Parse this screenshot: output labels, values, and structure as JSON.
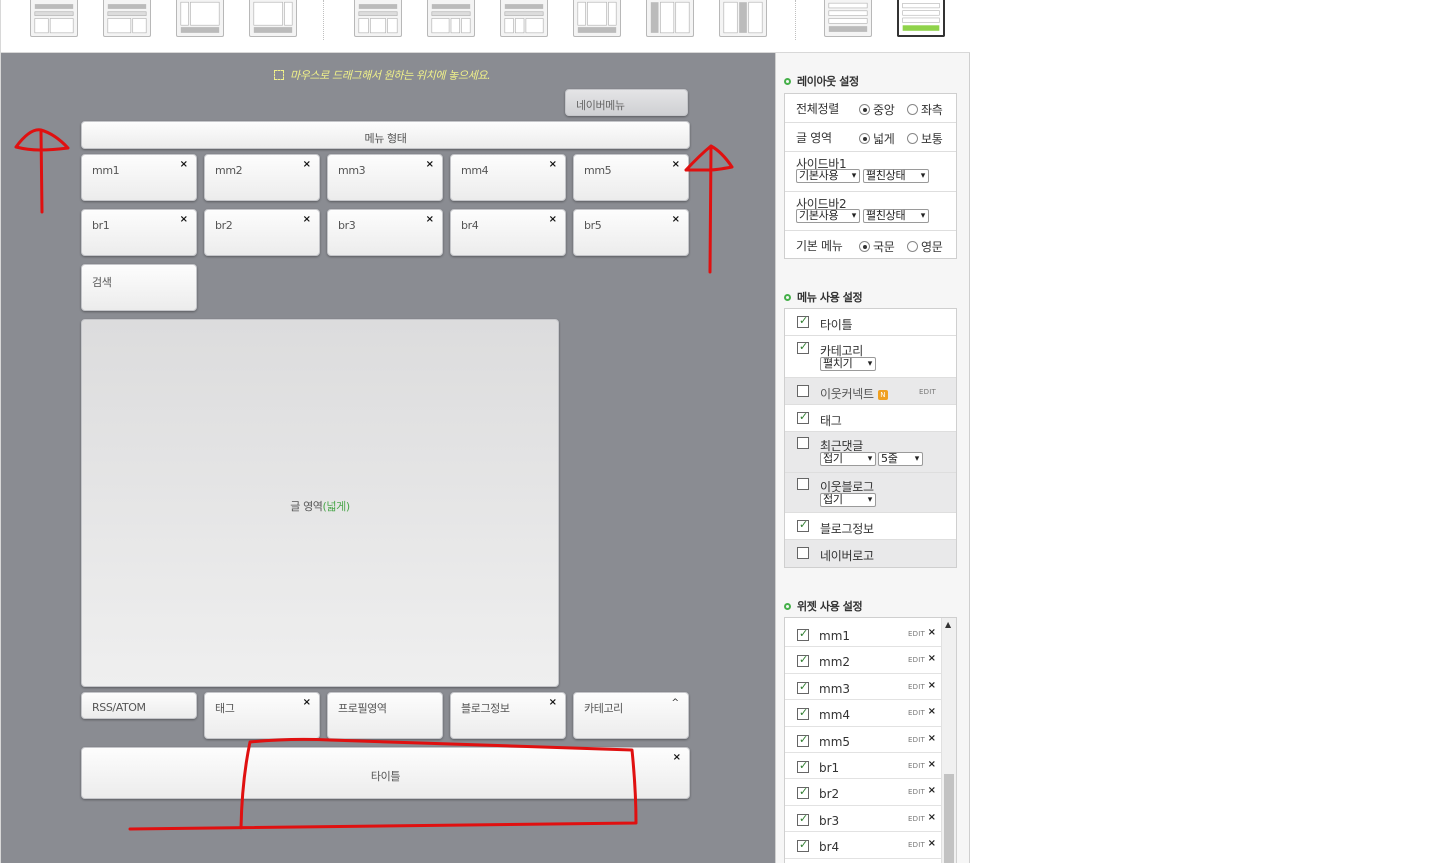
{
  "canvas": {
    "hint": "마우스로 드래그해서 원하는 위치에 놓으세요.",
    "naver_menu": "네이버메뉴",
    "menu_type": "메뉴 형태",
    "row1": [
      "mm1",
      "mm2",
      "mm3",
      "mm4",
      "mm5"
    ],
    "row2": [
      "br1",
      "br2",
      "br3",
      "br4",
      "br5"
    ],
    "search": "검색",
    "article_area": "글 영역",
    "article_mode": "(넓게)",
    "bottom": [
      "RSS/ATOM",
      "태그",
      "프로필영역",
      "블로그정보",
      "카테고리"
    ],
    "title": "타이틀",
    "close_glyph": "×",
    "chevron_glyph": "^"
  },
  "sidebar": {
    "layout_title": "레이아웃 설정",
    "layout": {
      "align_label": "전체정렬",
      "align_opt1": "중앙",
      "align_opt2": "좌측",
      "text_label": "글 영역",
      "text_opt1": "넓게",
      "text_opt2": "보통",
      "sidebar1_label": "사이드바1",
      "sidebar1_sel1": "기본사용",
      "sidebar1_sel2": "펼친상태",
      "sidebar2_label": "사이드바2",
      "sidebar2_sel1": "기본사용",
      "sidebar2_sel2": "펼친상태",
      "menu_label": "기본 메뉴",
      "menu_opt1": "국문",
      "menu_opt2": "영문"
    },
    "menu_title": "메뉴 사용 설정",
    "menu": {
      "title_item": "타이틀",
      "category_item": "카테고리",
      "category_sel": "펼치기",
      "neighbor_connect": "이웃커넥트",
      "n_badge": "N",
      "edit": "EDIT",
      "tag_item": "태그",
      "recent_comments": "최근댓글",
      "recent_sel1": "접기",
      "recent_sel2": "5줄",
      "neighbor_blog": "이웃블로그",
      "neighbor_sel": "접기",
      "blog_info": "블로그정보",
      "naver_logo": "네이버로고"
    },
    "widget_title": "위젯 사용 설정",
    "widgets": [
      "mm1",
      "mm2",
      "mm3",
      "mm4",
      "mm5",
      "br1",
      "br2",
      "br3",
      "br4"
    ],
    "widget_edit": "EDIT",
    "widget_close": "×"
  },
  "colors": {
    "canvas_bg": "#8a8c92",
    "hint_text": "#f1f28a",
    "accent_green": "#46b04a",
    "annotation_red": "#e01010"
  }
}
